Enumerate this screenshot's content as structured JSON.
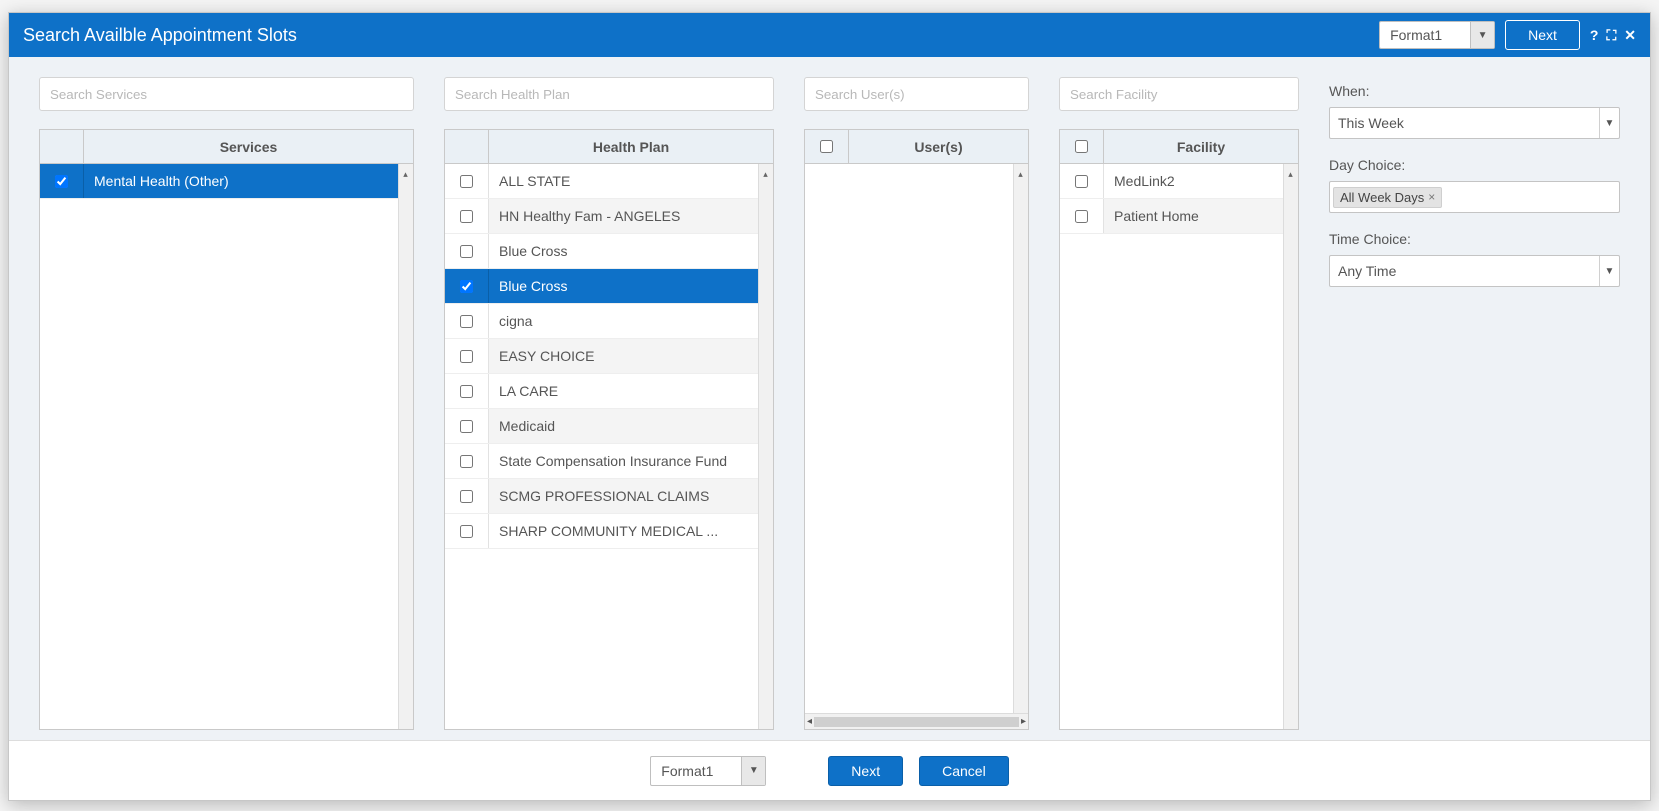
{
  "dialog": {
    "title": "Search Availble Appointment Slots",
    "format": "Format1",
    "next": "Next"
  },
  "searches": {
    "services_ph": "Search Services",
    "health_ph": "Search Health Plan",
    "users_ph": "Search User(s)",
    "facility_ph": "Search Facility"
  },
  "headers": {
    "services": "Services",
    "health": "Health Plan",
    "users": "User(s)",
    "facility": "Facility"
  },
  "services": [
    {
      "label": "Mental Health (Other)",
      "checked": true,
      "selected": true
    }
  ],
  "health": [
    {
      "label": "ALL STATE",
      "checked": false
    },
    {
      "label": "HN Healthy Fam - ANGELES",
      "checked": false
    },
    {
      "label": "Blue Cross",
      "checked": false
    },
    {
      "label": "Blue Cross",
      "checked": true,
      "selected": true
    },
    {
      "label": "cigna",
      "checked": false
    },
    {
      "label": "EASY CHOICE",
      "checked": false
    },
    {
      "label": "LA CARE",
      "checked": false
    },
    {
      "label": "Medicaid",
      "checked": false
    },
    {
      "label": "State Compensation Insurance Fund",
      "checked": false
    },
    {
      "label": "SCMG PROFESSIONAL CLAIMS",
      "checked": false
    },
    {
      "label": "SHARP COMMUNITY MEDICAL ...",
      "checked": false
    }
  ],
  "users": [],
  "facility": [
    {
      "label": "MedLink2",
      "checked": false
    },
    {
      "label": "Patient Home",
      "checked": false
    }
  ],
  "filters": {
    "when_label": "When:",
    "when_value": "This Week",
    "day_label": "Day Choice:",
    "day_tag": "All Week Days",
    "time_label": "Time Choice:",
    "time_value": "Any Time"
  },
  "footer": {
    "format": "Format1",
    "next": "Next",
    "cancel": "Cancel"
  }
}
